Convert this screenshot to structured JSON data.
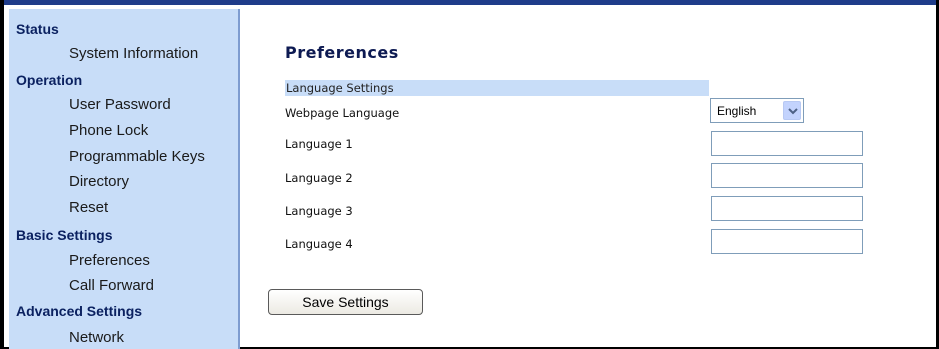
{
  "sidebar": {
    "groups": [
      {
        "label": "Status",
        "items": [
          "System Information"
        ]
      },
      {
        "label": "Operation",
        "items": [
          "User Password",
          "Phone Lock",
          "Programmable Keys",
          "Directory",
          "Reset"
        ]
      },
      {
        "label": "Basic Settings",
        "items": [
          "Preferences",
          "Call Forward"
        ]
      },
      {
        "label": "Advanced Settings",
        "items": [
          "Network"
        ]
      }
    ]
  },
  "page": {
    "title": "Preferences",
    "section": "Language Settings",
    "fields": {
      "webpage_language": {
        "label": "Webpage Language",
        "value": "English"
      },
      "language_1": {
        "label": "Language 1",
        "value": ""
      },
      "language_2": {
        "label": "Language 2",
        "value": ""
      },
      "language_3": {
        "label": "Language 3",
        "value": ""
      },
      "language_4": {
        "label": "Language 4",
        "value": ""
      }
    },
    "save_label": "Save Settings"
  },
  "colors": {
    "sidebar_bg": "#c8ddf8",
    "group_text": "#0b2160",
    "title_text": "#0d1a52",
    "top_bar": "#1f3c8a"
  },
  "icons": {
    "dropdown": "chevron-down-icon"
  }
}
